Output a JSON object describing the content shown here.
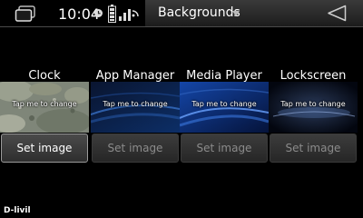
{
  "statusbar": {
    "time": "10:04",
    "app_title": "Backgrounds",
    "icons": [
      "windows-icon",
      "alarm-icon",
      "battery-icon",
      "signal-icon",
      "menu-arrow-icon",
      "back-icon"
    ]
  },
  "wallpapers": [
    {
      "name": "Clock",
      "tap_label": "Tap me to change",
      "button_label": "Set image",
      "button_enabled": true
    },
    {
      "name": "App Manager",
      "tap_label": "Tap me to change",
      "button_label": "Set image",
      "button_enabled": false
    },
    {
      "name": "Media Player",
      "tap_label": "Tap me to change",
      "button_label": "Set image",
      "button_enabled": false
    },
    {
      "name": "Lockscreen",
      "tap_label": "Tap me to change",
      "button_label": "Set image",
      "button_enabled": false
    }
  ],
  "footer": {
    "text": "D-livil"
  },
  "colors": {
    "background": "#000000",
    "statusbar": "#2a2a2a",
    "button_text_disabled": "#8b8b8b"
  }
}
